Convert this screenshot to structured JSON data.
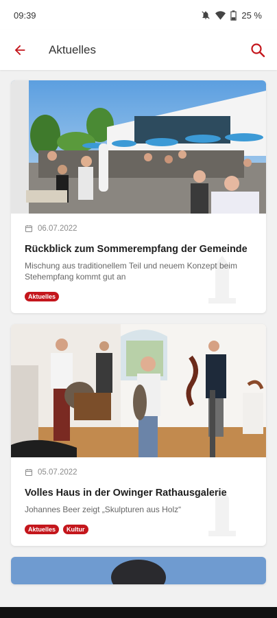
{
  "status": {
    "time": "09:39",
    "battery": "25 %"
  },
  "header": {
    "title": "Aktuelles"
  },
  "icons": {
    "back": "arrow-left-icon",
    "search": "search-icon",
    "date": "calendar-icon"
  },
  "colors": {
    "accent": "#c4161c"
  },
  "articles": [
    {
      "date": "06.07.2022",
      "title": "Rückblick zum Sommerempfang der Gemeinde",
      "subtitle": "Mischung aus traditionellem Teil und neuem Konzept beim Stehempfang kommt gut an",
      "tags": [
        "Aktuelles"
      ]
    },
    {
      "date": "05.07.2022",
      "title": "Volles Haus in der Owinger Rathausgalerie",
      "subtitle": "Johannes Beer zeigt „Skulpturen aus Holz“",
      "tags": [
        "Aktuelles",
        "Kultur"
      ]
    }
  ]
}
